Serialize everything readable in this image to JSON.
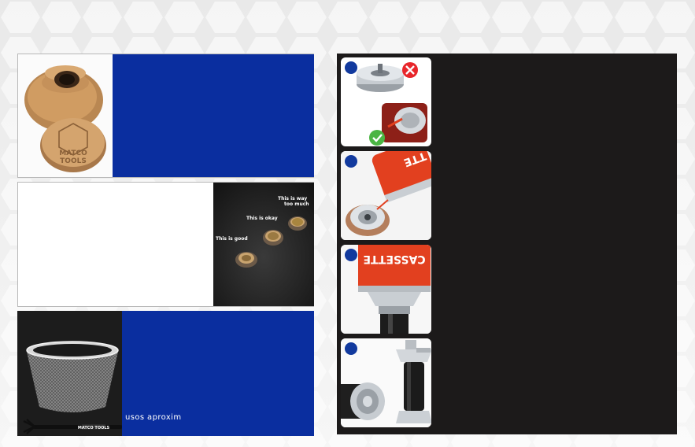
{
  "left_panels": {
    "panel1": {
      "logo_text": [
        "MATCO",
        "TOOLS"
      ]
    },
    "panel2": {
      "labels": {
        "good": "This is good",
        "okay": "This is okay",
        "too_much_line1": "This is way",
        "too_much_line2": "too much"
      }
    },
    "panel3": {
      "caption": "usos aproxim",
      "brush_brand": "MATCO TOOLS"
    }
  },
  "right_panel": {
    "steps": [
      {
        "icon_top": "x-circle-icon",
        "icon_bottom": "check-circle-icon"
      },
      {
        "canister_text": "TTE"
      },
      {
        "canister_text": "CASSETTE"
      },
      {}
    ]
  },
  "colors": {
    "blue": "#0a2e9f",
    "dark": "#1c1a1a",
    "step_number": "#123a9e",
    "error_red": "#e8262b",
    "ok_green": "#4bb543",
    "canister_red": "#e2401f"
  }
}
